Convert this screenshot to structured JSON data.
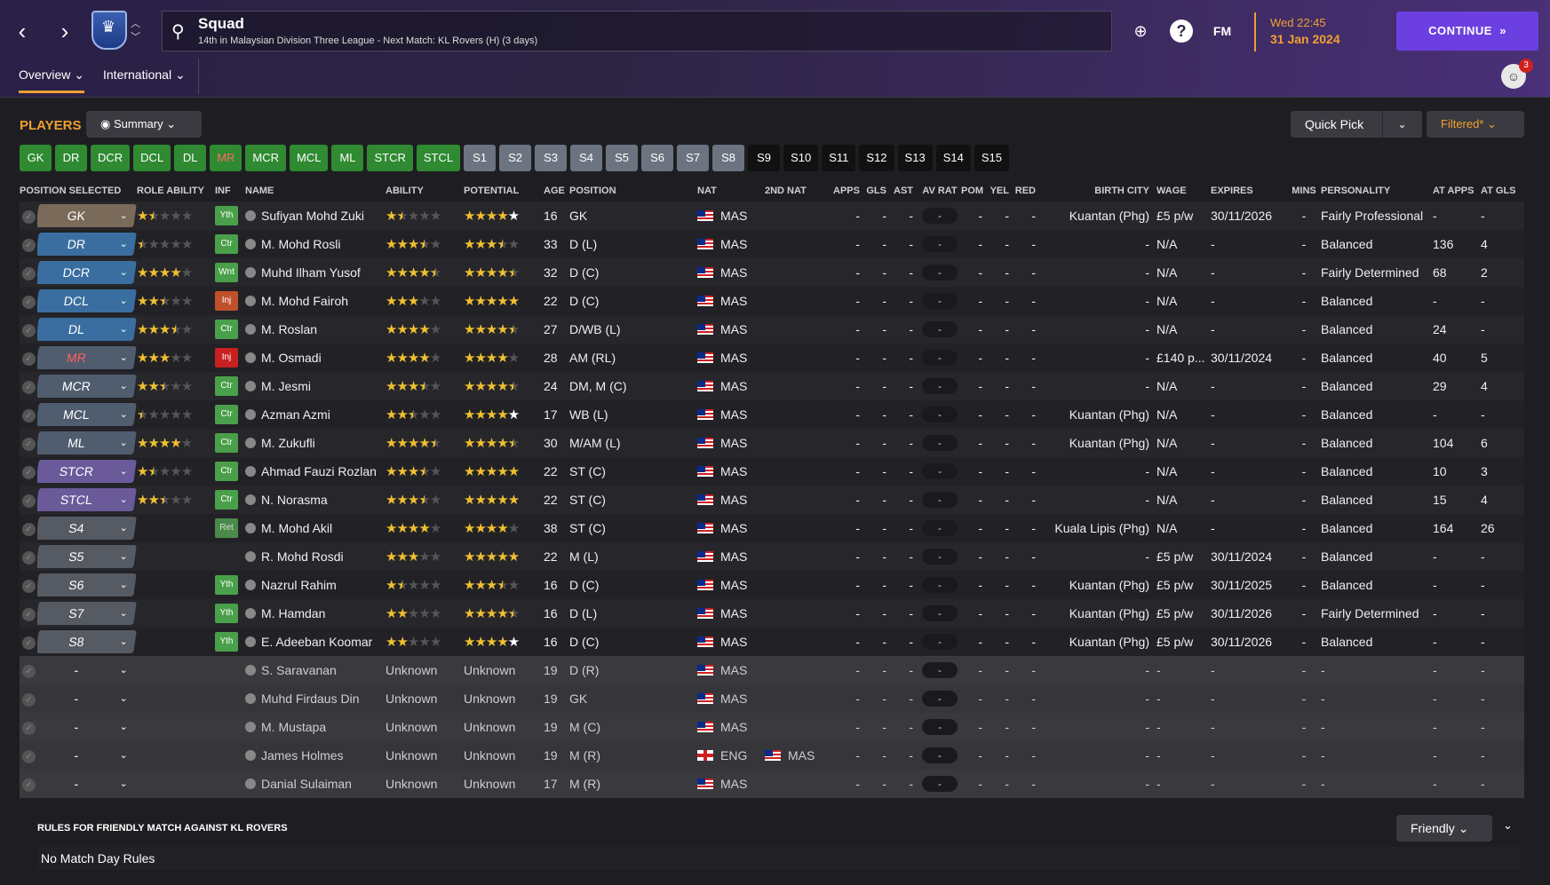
{
  "header": {
    "title": "Squad",
    "subtitle": "14th in Malaysian Division Three League - Next Match: KL Rovers (H) (3 days)",
    "fm_logo": "FM",
    "date_time": "Wed 22:45",
    "date_date": "31 Jan 2024",
    "continue_label": "CONTINUE",
    "help_label": "?",
    "notification_count": "3"
  },
  "subtabs": [
    {
      "label": "Overview"
    },
    {
      "label": "International"
    }
  ],
  "toolbar": {
    "players_title": "PLAYERS",
    "view_label": "Summary",
    "quick_pick_label": "Quick Pick",
    "filter_label": "Filtered*"
  },
  "chips": [
    {
      "label": "GK",
      "style": "green"
    },
    {
      "label": "DR",
      "style": "green"
    },
    {
      "label": "DCR",
      "style": "green"
    },
    {
      "label": "DCL",
      "style": "green"
    },
    {
      "label": "DL",
      "style": "green"
    },
    {
      "label": "MR",
      "style": "green-red"
    },
    {
      "label": "MCR",
      "style": "green"
    },
    {
      "label": "MCL",
      "style": "green"
    },
    {
      "label": "ML",
      "style": "green"
    },
    {
      "label": "STCR",
      "style": "green"
    },
    {
      "label": "STCL",
      "style": "green"
    },
    {
      "label": "S1",
      "style": "grey"
    },
    {
      "label": "S2",
      "style": "grey"
    },
    {
      "label": "S3",
      "style": "grey"
    },
    {
      "label": "S4",
      "style": "grey"
    },
    {
      "label": "S5",
      "style": "grey"
    },
    {
      "label": "S6",
      "style": "grey"
    },
    {
      "label": "S7",
      "style": "grey"
    },
    {
      "label": "S8",
      "style": "grey"
    },
    {
      "label": "S9",
      "style": "dark"
    },
    {
      "label": "S10",
      "style": "dark"
    },
    {
      "label": "S11",
      "style": "dark"
    },
    {
      "label": "S12",
      "style": "dark"
    },
    {
      "label": "S13",
      "style": "dark"
    },
    {
      "label": "S14",
      "style": "dark"
    },
    {
      "label": "S15",
      "style": "dark"
    }
  ],
  "columns": {
    "position_selected": "POSITION SELECTED",
    "role_ability": "ROLE ABILITY",
    "inf": "INF",
    "name": "NAME",
    "ability": "ABILITY",
    "potential": "POTENTIAL",
    "age": "AGE",
    "position": "POSITION",
    "nat": "NAT",
    "nat2": "2ND NAT",
    "apps": "APPS",
    "gls": "GLS",
    "ast": "AST",
    "avrat": "AV RAT",
    "pom": "POM",
    "yel": "YEL",
    "red": "RED",
    "birth_city": "BIRTH CITY",
    "wage": "WAGE",
    "expires": "EXPIRES",
    "mins": "MINS",
    "personality": "PERSONALITY",
    "at_apps": "AT APPS",
    "at_gls": "AT GLS"
  },
  "players": [
    {
      "pos_sel": "GK",
      "pos_style": "gk",
      "role": 1.5,
      "inf": "Yth",
      "name": "Sufiyan Mohd Zuki",
      "ability": 1.5,
      "potential": 5,
      "potential_white": true,
      "age": "16",
      "position": "GK",
      "nat": "MAS",
      "nat2": "",
      "apps": "-",
      "gls": "-",
      "ast": "-",
      "avrat": "-",
      "pom": "-",
      "yel": "-",
      "red": "-",
      "city": "Kuantan (Phg)",
      "wage": "£5 p/w",
      "expires": "30/11/2026",
      "mins": "-",
      "personality": "Fairly Professional",
      "at_apps": "-",
      "at_gls": "-"
    },
    {
      "pos_sel": "DR",
      "pos_style": "def",
      "role": 0.5,
      "inf": "Ctr",
      "name": "M. Mohd Rosli",
      "ability": 3.5,
      "potential": 3.5,
      "age": "33",
      "position": "D (L)",
      "nat": "MAS",
      "nat2": "",
      "apps": "-",
      "gls": "-",
      "ast": "-",
      "avrat": "-",
      "pom": "-",
      "yel": "-",
      "red": "-",
      "city": "-",
      "wage": "N/A",
      "expires": "-",
      "mins": "-",
      "personality": "Balanced",
      "at_apps": "136",
      "at_gls": "4"
    },
    {
      "pos_sel": "DCR",
      "pos_style": "def",
      "role": 4,
      "inf": "Wnt",
      "name": "Muhd Ilham Yusof",
      "ability": 4.5,
      "potential": 4.5,
      "age": "32",
      "position": "D (C)",
      "nat": "MAS",
      "nat2": "",
      "apps": "-",
      "gls": "-",
      "ast": "-",
      "avrat": "-",
      "pom": "-",
      "yel": "-",
      "red": "-",
      "city": "-",
      "wage": "N/A",
      "expires": "-",
      "mins": "-",
      "personality": "Fairly Determined",
      "at_apps": "68",
      "at_gls": "2"
    },
    {
      "pos_sel": "DCL",
      "pos_style": "def",
      "role": 2.5,
      "inf": "Inj",
      "inf_style": "inj",
      "name": "M. Mohd Fairoh",
      "ability": 3,
      "potential": 5,
      "age": "22",
      "position": "D (C)",
      "nat": "MAS",
      "nat2": "",
      "apps": "-",
      "gls": "-",
      "ast": "-",
      "avrat": "-",
      "pom": "-",
      "yel": "-",
      "red": "-",
      "city": "-",
      "wage": "N/A",
      "expires": "-",
      "mins": "-",
      "personality": "Balanced",
      "at_apps": "-",
      "at_gls": "-"
    },
    {
      "pos_sel": "DL",
      "pos_style": "def",
      "role": 3.5,
      "inf": "Ctr",
      "name": "M. Roslan",
      "ability": 4,
      "potential": 4.5,
      "age": "27",
      "position": "D/WB (L)",
      "nat": "MAS",
      "nat2": "",
      "apps": "-",
      "gls": "-",
      "ast": "-",
      "avrat": "-",
      "pom": "-",
      "yel": "-",
      "red": "-",
      "city": "-",
      "wage": "N/A",
      "expires": "-",
      "mins": "-",
      "personality": "Balanced",
      "at_apps": "24",
      "at_gls": "-"
    },
    {
      "pos_sel": "MR",
      "pos_style": "mid",
      "pos_red": true,
      "role": 3,
      "inf": "Inj",
      "inf_style": "injr",
      "name": "M. Osmadi",
      "ability": 4,
      "potential": 4,
      "age": "28",
      "position": "AM (RL)",
      "nat": "MAS",
      "nat2": "",
      "apps": "-",
      "gls": "-",
      "ast": "-",
      "avrat": "-",
      "pom": "-",
      "yel": "-",
      "red": "-",
      "city": "-",
      "wage": "£140 p...",
      "expires": "30/11/2024",
      "mins": "-",
      "personality": "Balanced",
      "at_apps": "40",
      "at_gls": "5"
    },
    {
      "pos_sel": "MCR",
      "pos_style": "mid",
      "role": 2.5,
      "inf": "Ctr",
      "name": "M. Jesmi",
      "ability": 3.5,
      "potential": 4.5,
      "age": "24",
      "position": "DM, M (C)",
      "nat": "MAS",
      "nat2": "",
      "apps": "-",
      "gls": "-",
      "ast": "-",
      "avrat": "-",
      "pom": "-",
      "yel": "-",
      "red": "-",
      "city": "-",
      "wage": "N/A",
      "expires": "-",
      "mins": "-",
      "personality": "Balanced",
      "at_apps": "29",
      "at_gls": "4"
    },
    {
      "pos_sel": "MCL",
      "pos_style": "mid",
      "role": 0.5,
      "inf": "Ctr",
      "name": "Azman Azmi",
      "ability": 2.5,
      "potential": 4,
      "potential_white": true,
      "age": "17",
      "position": "WB (L)",
      "nat": "MAS",
      "nat2": "",
      "apps": "-",
      "gls": "-",
      "ast": "-",
      "avrat": "-",
      "pom": "-",
      "yel": "-",
      "red": "-",
      "city": "Kuantan (Phg)",
      "wage": "N/A",
      "expires": "-",
      "mins": "-",
      "personality": "Balanced",
      "at_apps": "-",
      "at_gls": "-"
    },
    {
      "pos_sel": "ML",
      "pos_style": "mid",
      "role": 4,
      "inf": "Ctr",
      "name": "M. Zukufli",
      "ability": 4.5,
      "potential": 4.5,
      "age": "30",
      "position": "M/AM (L)",
      "nat": "MAS",
      "nat2": "",
      "apps": "-",
      "gls": "-",
      "ast": "-",
      "avrat": "-",
      "pom": "-",
      "yel": "-",
      "red": "-",
      "city": "Kuantan (Phg)",
      "wage": "N/A",
      "expires": "-",
      "mins": "-",
      "personality": "Balanced",
      "at_apps": "104",
      "at_gls": "6"
    },
    {
      "pos_sel": "STCR",
      "pos_style": "att",
      "role": 1.5,
      "inf": "Ctr",
      "name": "Ahmad Fauzi Rozlan",
      "ability": 3.5,
      "potential": 5,
      "age": "22",
      "position": "ST (C)",
      "nat": "MAS",
      "nat2": "",
      "apps": "-",
      "gls": "-",
      "ast": "-",
      "avrat": "-",
      "pom": "-",
      "yel": "-",
      "red": "-",
      "city": "-",
      "wage": "N/A",
      "expires": "-",
      "mins": "-",
      "personality": "Balanced",
      "at_apps": "10",
      "at_gls": "3"
    },
    {
      "pos_sel": "STCL",
      "pos_style": "att",
      "role": 2.5,
      "inf": "Ctr",
      "name": "N. Norasma",
      "ability": 3.5,
      "potential": 5,
      "age": "22",
      "position": "ST (C)",
      "nat": "MAS",
      "nat2": "",
      "apps": "-",
      "gls": "-",
      "ast": "-",
      "avrat": "-",
      "pom": "-",
      "yel": "-",
      "red": "-",
      "city": "-",
      "wage": "N/A",
      "expires": "-",
      "mins": "-",
      "personality": "Balanced",
      "at_apps": "15",
      "at_gls": "4"
    },
    {
      "pos_sel": "S4",
      "pos_style": "sub",
      "role": null,
      "inf": "Ret",
      "inf_style": "ret",
      "name": "M. Mohd Akil",
      "ability": 4,
      "potential": 4,
      "age": "38",
      "position": "ST (C)",
      "nat": "MAS",
      "nat2": "",
      "apps": "-",
      "gls": "-",
      "ast": "-",
      "avrat": "-",
      "pom": "-",
      "yel": "-",
      "red": "-",
      "city": "Kuala Lipis (Phg)",
      "wage": "N/A",
      "expires": "-",
      "mins": "-",
      "personality": "Balanced",
      "at_apps": "164",
      "at_gls": "26"
    },
    {
      "pos_sel": "S5",
      "pos_style": "sub",
      "role": null,
      "inf": "",
      "name": "R. Mohd Rosdi",
      "ability": 3,
      "potential": 5,
      "age": "22",
      "position": "M (L)",
      "nat": "MAS",
      "nat2": "",
      "apps": "-",
      "gls": "-",
      "ast": "-",
      "avrat": "-",
      "pom": "-",
      "yel": "-",
      "red": "-",
      "city": "-",
      "wage": "£5 p/w",
      "expires": "30/11/2024",
      "mins": "-",
      "personality": "Balanced",
      "at_apps": "-",
      "at_gls": "-"
    },
    {
      "pos_sel": "S6",
      "pos_style": "sub",
      "role": null,
      "inf": "Yth",
      "name": "Nazrul Rahim",
      "ability": 1.5,
      "potential": 3.5,
      "potential_white": true,
      "age": "16",
      "position": "D (C)",
      "nat": "MAS",
      "nat2": "",
      "apps": "-",
      "gls": "-",
      "ast": "-",
      "avrat": "-",
      "pom": "-",
      "yel": "-",
      "red": "-",
      "city": "Kuantan (Phg)",
      "wage": "£5 p/w",
      "expires": "30/11/2025",
      "mins": "-",
      "personality": "Balanced",
      "at_apps": "-",
      "at_gls": "-"
    },
    {
      "pos_sel": "S7",
      "pos_style": "sub",
      "role": null,
      "inf": "Yth",
      "name": "M. Hamdan",
      "ability": 2,
      "potential": 4.5,
      "potential_white": true,
      "age": "16",
      "position": "D (L)",
      "nat": "MAS",
      "nat2": "",
      "apps": "-",
      "gls": "-",
      "ast": "-",
      "avrat": "-",
      "pom": "-",
      "yel": "-",
      "red": "-",
      "city": "Kuantan (Phg)",
      "wage": "£5 p/w",
      "expires": "30/11/2026",
      "mins": "-",
      "personality": "Fairly Determined",
      "at_apps": "-",
      "at_gls": "-"
    },
    {
      "pos_sel": "S8",
      "pos_style": "sub",
      "role": null,
      "inf": "Yth",
      "name": "E. Adeeban Koomar",
      "ability": 2,
      "potential": 5,
      "potential_white": true,
      "age": "16",
      "position": "D (C)",
      "nat": "MAS",
      "nat2": "",
      "apps": "-",
      "gls": "-",
      "ast": "-",
      "avrat": "-",
      "pom": "-",
      "yel": "-",
      "red": "-",
      "city": "Kuantan (Phg)",
      "wage": "£5 p/w",
      "expires": "30/11/2026",
      "mins": "-",
      "personality": "Balanced",
      "at_apps": "-",
      "at_gls": "-"
    },
    {
      "pos_sel": "-",
      "pos_style": "none",
      "unknown": true,
      "role": null,
      "inf": "",
      "name": "S. Saravanan",
      "ability_text": "Unknown",
      "potential_text": "Unknown",
      "age": "19",
      "position": "D (R)",
      "nat": "MAS",
      "nat2": "",
      "apps": "-",
      "gls": "-",
      "ast": "-",
      "avrat": "-",
      "pom": "-",
      "yel": "-",
      "red": "-",
      "city": "-",
      "wage": "-",
      "expires": "-",
      "mins": "-",
      "personality": "-",
      "at_apps": "-",
      "at_gls": "-"
    },
    {
      "pos_sel": "-",
      "pos_style": "none",
      "unknown": true,
      "role": null,
      "inf": "",
      "name": "Muhd Firdaus Din",
      "ability_text": "Unknown",
      "potential_text": "Unknown",
      "age": "19",
      "position": "GK",
      "nat": "MAS",
      "nat2": "",
      "apps": "-",
      "gls": "-",
      "ast": "-",
      "avrat": "-",
      "pom": "-",
      "yel": "-",
      "red": "-",
      "city": "-",
      "wage": "-",
      "expires": "-",
      "mins": "-",
      "personality": "-",
      "at_apps": "-",
      "at_gls": "-"
    },
    {
      "pos_sel": "-",
      "pos_style": "none",
      "unknown": true,
      "role": null,
      "inf": "",
      "name": "M. Mustapa",
      "ability_text": "Unknown",
      "potential_text": "Unknown",
      "age": "19",
      "position": "M (C)",
      "nat": "MAS",
      "nat2": "",
      "apps": "-",
      "gls": "-",
      "ast": "-",
      "avrat": "-",
      "pom": "-",
      "yel": "-",
      "red": "-",
      "city": "-",
      "wage": "-",
      "expires": "-",
      "mins": "-",
      "personality": "-",
      "at_apps": "-",
      "at_gls": "-"
    },
    {
      "pos_sel": "-",
      "pos_style": "none",
      "unknown": true,
      "role": null,
      "inf": "",
      "name": "James Holmes",
      "ability_text": "Unknown",
      "potential_text": "Unknown",
      "age": "19",
      "position": "M (R)",
      "nat": "ENG",
      "nat_flag": "eng",
      "nat2": "MAS",
      "apps": "-",
      "gls": "-",
      "ast": "-",
      "avrat": "-",
      "pom": "-",
      "yel": "-",
      "red": "-",
      "city": "-",
      "wage": "-",
      "expires": "-",
      "mins": "-",
      "personality": "-",
      "at_apps": "-",
      "at_gls": "-"
    },
    {
      "pos_sel": "-",
      "pos_style": "none",
      "unknown": true,
      "role": null,
      "inf": "",
      "name": "Danial Sulaiman",
      "ability_text": "Unknown",
      "potential_text": "Unknown",
      "age": "17",
      "position": "M (R)",
      "nat": "MAS",
      "nat2": "",
      "apps": "-",
      "gls": "-",
      "ast": "-",
      "avrat": "-",
      "pom": "-",
      "yel": "-",
      "red": "-",
      "city": "-",
      "wage": "-",
      "expires": "-",
      "mins": "-",
      "personality": "-",
      "at_apps": "-",
      "at_gls": "-"
    }
  ],
  "rules": {
    "title": "RULES FOR FRIENDLY MATCH AGAINST KL ROVERS",
    "select_label": "Friendly",
    "line": "No Match Day Rules"
  },
  "colors": {
    "accent": "#f0a030",
    "continue": "#6c3fe0",
    "star": "#f0c030"
  }
}
